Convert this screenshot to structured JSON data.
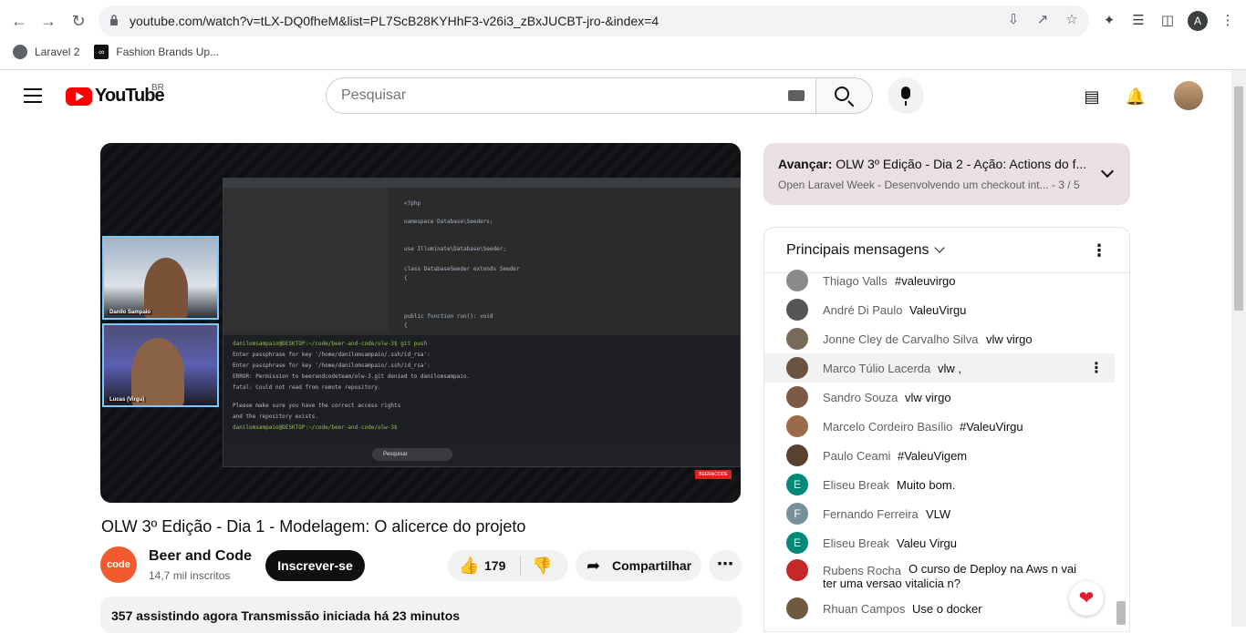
{
  "browser": {
    "url": "youtube.com/watch?v=tLX-DQ0fheM&list=PL7ScB28KYHhF3-v26i3_zBxJUCBT-jro-&index=4",
    "profile_initial": "A",
    "bookmarks": [
      {
        "label": "Laravel 2"
      },
      {
        "label": "Fashion Brands Up..."
      }
    ]
  },
  "header": {
    "logo_text": "YouTube",
    "region": "BR",
    "search_placeholder": "Pesquisar"
  },
  "video": {
    "title": "OLW 3º Edição - Dia 1 - Modelagem: O alicerce do projeto",
    "channel_name": "Beer and Code",
    "channel_avatar_text": "code",
    "subscribers": "14,7 mil inscritos",
    "subscribe_label": "Inscrever-se",
    "likes": "179",
    "share_label": "Compartilhar",
    "description_stats": "357 assistindo agora  Transmissão iniciada há 23 minutos",
    "cam1_label": "Danilo Sampaio",
    "cam2_label": "Lucas (Virgu)",
    "taskbar_search": "Pesquisar",
    "code_lines": [
      "<?php",
      "namespace Database\\Seeders;",
      "use Illuminate\\Database\\Seeder;",
      "class DatabaseSeeder extends Seeder",
      "{",
      "    public function run(): void",
      "    {"
    ],
    "terminal_lines": [
      "danilomsampaio@DESKTOP:~/code/beer-and-code/olw-3$ git push",
      "Enter passphrase for key '/home/danilomsampaio/.ssh/id_rsa':",
      "Enter passphrase for key '/home/danilomsampaio/.ssh/id_rsa':",
      "ERROR: Permission to beerandcodeteam/olw-3.git denied to danilomsampaio.",
      "fatal: Could not read from remote repository.",
      "",
      "Please make sure you have the correct access rights",
      "and the repository exists.",
      "danilomsampaio@DESKTOP:~/code/beer-and-code/olw-3$"
    ]
  },
  "playlist": {
    "next_prefix": "Avançar:",
    "next_title": "OLW 3º Edição - Dia 2 - Ação: Actions do f...",
    "list_name": "Open Laravel Week - Desenvolvendo um checkout int...",
    "position": "3 / 5"
  },
  "chat": {
    "title": "Principais mensagens",
    "messages": [
      {
        "author": "Thiago Valls",
        "text": "#valeuvirgo",
        "avatar": "",
        "color": "#8a8a8a"
      },
      {
        "author": "André Di Paulo",
        "text": "ValeuVirgu",
        "avatar": "",
        "color": "#555555"
      },
      {
        "author": "Jonne Cley de Carvalho Silva",
        "text": "vlw virgo",
        "avatar": "",
        "color": "#7a6a5a"
      },
      {
        "author": "Marco Túlio Lacerda",
        "text": "vlw ,",
        "avatar": "",
        "color": "#6b5242"
      },
      {
        "author": "Sandro Souza",
        "text": "vlw virgo",
        "avatar": "",
        "color": "#7a5a45"
      },
      {
        "author": "Marcelo Cordeiro Basílio",
        "text": "#ValeuVirgu",
        "avatar": "",
        "color": "#9a6a4a"
      },
      {
        "author": "Paulo Ceami",
        "text": "#ValeuVigem",
        "avatar": "",
        "color": "#5a4030"
      },
      {
        "author": "Eliseu Break",
        "text": "Muito bom.",
        "avatar": "E",
        "color": "#00897b"
      },
      {
        "author": "Fernando Ferreira",
        "text": "VLW",
        "avatar": "F",
        "color": "#78909c"
      },
      {
        "author": "Eliseu Break",
        "text": "Valeu Virgu",
        "avatar": "E",
        "color": "#00897b"
      },
      {
        "author": "Rubens Rocha",
        "text": "O curso de Deploy na Aws n vai ter uma versao vitalicia n?",
        "avatar": "",
        "color": "#c62828"
      },
      {
        "author": "Rhuan Campos",
        "text": "Use o docker",
        "avatar": "",
        "color": "#6d5a40"
      }
    ]
  }
}
